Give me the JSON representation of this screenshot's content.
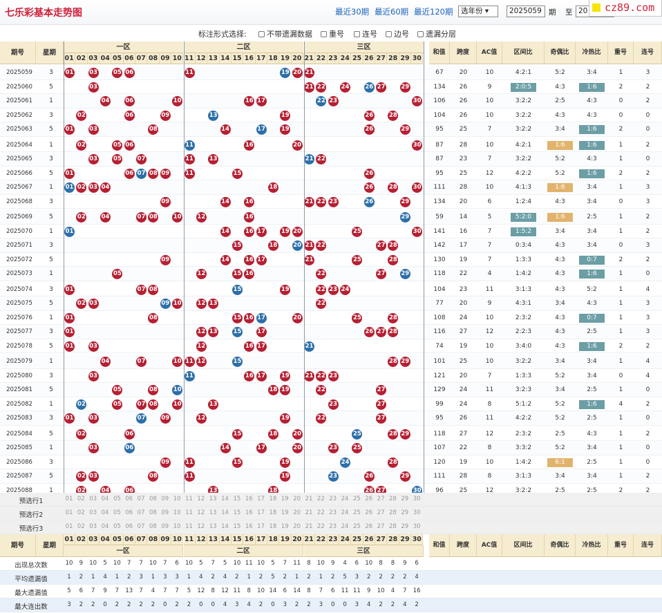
{
  "title": "七乐彩基本走势图",
  "periods": [
    "最近30期",
    "最近60期",
    "最近120期"
  ],
  "year_select": "选年份",
  "from_value": "2025059",
  "from_label": "期",
  "to_label": "至",
  "to_value": "20",
  "logo": "cz89.com",
  "options": {
    "label": "标注形式选择:",
    "items": [
      "不带遗漏数据",
      "重号",
      "连号",
      "边号",
      "遗漏分层"
    ]
  },
  "header": {
    "issue": "期号",
    "week": "星期",
    "zones": [
      "一区",
      "二区",
      "三区"
    ],
    "nums": [
      "01",
      "02",
      "03",
      "04",
      "05",
      "06",
      "07",
      "08",
      "09",
      "10",
      "11",
      "12",
      "13",
      "14",
      "15",
      "16",
      "17",
      "18",
      "19",
      "20",
      "21",
      "22",
      "23",
      "24",
      "25",
      "26",
      "27",
      "28",
      "29",
      "30"
    ],
    "cols": [
      "和值",
      "跨度",
      "AC值",
      "区间比",
      "奇偶比",
      "冷热比",
      "重号",
      "连号"
    ]
  },
  "rows": [
    {
      "id": "2025059",
      "w": "3",
      "s": "67",
      "k": "20",
      "ac": "10",
      "q": "4:2:1",
      "o": "5:2",
      "h": "3:4",
      "c": "1",
      "l": "3"
    },
    {
      "id": "2025060",
      "w": "5",
      "s": "134",
      "k": "26",
      "ac": "9",
      "q": "2:0:5",
      "o": "4:3",
      "h": "1:6",
      "c": "2",
      "l": "2"
    },
    {
      "id": "2025061",
      "w": "1",
      "s": "106",
      "k": "26",
      "ac": "10",
      "q": "3:2:2",
      "o": "2:5",
      "h": "4:3",
      "c": "0",
      "l": "2"
    },
    {
      "id": "2025062",
      "w": "3",
      "s": "104",
      "k": "26",
      "ac": "10",
      "q": "3:2:2",
      "o": "4:3",
      "h": "4:3",
      "c": "0",
      "l": "0"
    },
    {
      "id": "2025063",
      "w": "5",
      "s": "95",
      "k": "25",
      "ac": "7",
      "q": "3:2:2",
      "o": "3:4",
      "h": "1:6",
      "c": "2",
      "l": "0"
    },
    {
      "id": "2025064",
      "w": "1",
      "s": "87",
      "k": "28",
      "ac": "10",
      "q": "4:2:1",
      "o": "1:6",
      "h": "1:6",
      "c": "1",
      "l": "2"
    },
    {
      "id": "2025065",
      "w": "3",
      "s": "87",
      "k": "23",
      "ac": "7",
      "q": "3:2:2",
      "o": "5:2",
      "h": "4:3",
      "c": "1",
      "l": "0"
    },
    {
      "id": "2025066",
      "w": "5",
      "s": "95",
      "k": "25",
      "ac": "12",
      "q": "4:2:2",
      "o": "5:2",
      "h": "1:6",
      "c": "2",
      "l": "2"
    },
    {
      "id": "2025067",
      "w": "1",
      "s": "111",
      "k": "28",
      "ac": "10",
      "q": "4:1:3",
      "o": "1:6",
      "h": "3:4",
      "c": "1",
      "l": "3"
    },
    {
      "id": "2025068",
      "w": "3",
      "s": "134",
      "k": "20",
      "ac": "6",
      "q": "1:2:4",
      "o": "4:3",
      "h": "3:4",
      "c": "0",
      "l": "3"
    },
    {
      "id": "2025069",
      "w": "5",
      "s": "59",
      "k": "14",
      "ac": "5",
      "q": "5:2:0",
      "o": "1:6",
      "h": "2:5",
      "c": "1",
      "l": "2"
    },
    {
      "id": "2025070",
      "w": "1",
      "s": "141",
      "k": "16",
      "ac": "7",
      "q": "1:5:2",
      "o": "3:4",
      "h": "3:4",
      "c": "1",
      "l": "2"
    },
    {
      "id": "2025071",
      "w": "3",
      "s": "142",
      "k": "17",
      "ac": "7",
      "q": "0:3:4",
      "o": "4:3",
      "h": "3:4",
      "c": "0",
      "l": "3"
    },
    {
      "id": "2025072",
      "w": "5",
      "s": "130",
      "k": "19",
      "ac": "7",
      "q": "1:3:3",
      "o": "4:3",
      "h": "0:7",
      "c": "2",
      "l": "2"
    },
    {
      "id": "2025073",
      "w": "1",
      "s": "118",
      "k": "22",
      "ac": "4",
      "q": "1:4:2",
      "o": "4:3",
      "h": "1:6",
      "c": "1",
      "l": "0"
    },
    {
      "id": "2025074",
      "w": "3",
      "s": "104",
      "k": "23",
      "ac": "11",
      "q": "3:1:3",
      "o": "4:3",
      "h": "5:2",
      "c": "1",
      "l": "4"
    },
    {
      "id": "2025075",
      "w": "5",
      "s": "77",
      "k": "20",
      "ac": "9",
      "q": "4:3:1",
      "o": "3:4",
      "h": "4:3",
      "c": "1",
      "l": "3"
    },
    {
      "id": "2025076",
      "w": "1",
      "s": "108",
      "k": "24",
      "ac": "10",
      "q": "2:3:2",
      "o": "4:3",
      "h": "0:7",
      "c": "1",
      "l": "3"
    },
    {
      "id": "2025077",
      "w": "3",
      "s": "116",
      "k": "27",
      "ac": "12",
      "q": "2:2:3",
      "o": "4:3",
      "h": "2:5",
      "c": "1",
      "l": "3"
    },
    {
      "id": "2025078",
      "w": "5",
      "s": "74",
      "k": "19",
      "ac": "10",
      "q": "3:4:0",
      "o": "4:3",
      "h": "1:6",
      "c": "2",
      "l": "2"
    },
    {
      "id": "2025079",
      "w": "1",
      "s": "101",
      "k": "25",
      "ac": "10",
      "q": "3:2:2",
      "o": "3:4",
      "h": "3:4",
      "c": "1",
      "l": "4"
    },
    {
      "id": "2025080",
      "w": "3",
      "s": "121",
      "k": "20",
      "ac": "7",
      "q": "1:3:3",
      "o": "5:2",
      "h": "3:4",
      "c": "0",
      "l": "4"
    },
    {
      "id": "2025081",
      "w": "5",
      "s": "129",
      "k": "24",
      "ac": "11",
      "q": "3:2:3",
      "o": "3:4",
      "h": "2:5",
      "c": "1",
      "l": "0"
    },
    {
      "id": "2025082",
      "w": "1",
      "s": "99",
      "k": "24",
      "ac": "8",
      "q": "5:1:2",
      "o": "5:2",
      "h": "1:6",
      "c": "4",
      "l": "2"
    },
    {
      "id": "2025083",
      "w": "3",
      "s": "95",
      "k": "26",
      "ac": "11",
      "q": "4:2:2",
      "o": "5:2",
      "h": "2:5",
      "c": "1",
      "l": "0"
    },
    {
      "id": "2025084",
      "w": "5",
      "s": "118",
      "k": "27",
      "ac": "12",
      "q": "2:3:2",
      "o": "2:5",
      "h": "4:3",
      "c": "1",
      "l": "2"
    },
    {
      "id": "2025085",
      "w": "1",
      "s": "107",
      "k": "22",
      "ac": "8",
      "q": "3:3:2",
      "o": "5:2",
      "h": "3:4",
      "c": "1",
      "l": "0"
    },
    {
      "id": "2025086",
      "w": "3",
      "s": "120",
      "k": "19",
      "ac": "10",
      "q": "1:4:2",
      "o": "6:1",
      "h": "2:5",
      "c": "1",
      "l": "0"
    },
    {
      "id": "2025087",
      "w": "5",
      "s": "111",
      "k": "28",
      "ac": "8",
      "q": "3:1:3",
      "o": "3:4",
      "h": "3:4",
      "c": "1",
      "l": "2"
    },
    {
      "id": "2025088",
      "w": "1",
      "s": "96",
      "k": "25",
      "ac": "12",
      "q": "3:2:2",
      "o": "2:5",
      "h": "2:5",
      "c": "2",
      "l": "2"
    }
  ],
  "draws": [
    {
      "r": [
        1,
        3,
        5,
        6,
        11,
        20,
        21
      ],
      "b": [
        19
      ]
    },
    {
      "r": [
        3,
        21,
        22,
        24,
        27,
        29
      ],
      "b": [
        26
      ]
    },
    {
      "r": [
        4,
        6,
        10,
        16,
        17,
        23,
        30
      ],
      "b": [
        22
      ]
    },
    {
      "r": [
        2,
        6,
        9,
        19,
        26,
        28
      ],
      "b": [
        13
      ]
    },
    {
      "r": [
        1,
        3,
        8,
        14,
        19,
        26,
        29
      ],
      "b": [
        17
      ]
    },
    {
      "r": [
        2,
        5,
        6,
        11,
        16,
        20,
        30
      ],
      "b": [
        11
      ]
    },
    {
      "r": [
        3,
        5,
        7,
        11,
        13,
        21,
        22
      ],
      "b": [
        21
      ]
    },
    {
      "r": [
        1,
        6,
        8,
        9,
        11,
        15,
        26
      ],
      "b": [
        7
      ]
    },
    {
      "r": [
        2,
        3,
        4,
        18,
        26,
        28,
        30
      ],
      "b": [
        1
      ]
    },
    {
      "r": [
        9,
        14,
        16,
        21,
        22,
        23,
        29
      ],
      "b": [
        26
      ]
    },
    {
      "r": [
        2,
        4,
        7,
        8,
        10,
        12,
        16
      ],
      "b": [
        29
      ]
    },
    {
      "r": [
        14,
        16,
        17,
        19,
        20,
        25,
        30
      ],
      "b": [
        1
      ]
    },
    {
      "r": [
        15,
        18,
        21,
        22,
        27,
        28
      ],
      "b": [
        20
      ]
    },
    {
      "r": [
        9,
        14,
        16,
        17,
        21,
        25,
        28
      ],
      "b": []
    },
    {
      "r": [
        5,
        12,
        15,
        16,
        22,
        27
      ],
      "b": [
        29
      ]
    },
    {
      "r": [
        1,
        7,
        8,
        19,
        22,
        23,
        24
      ],
      "b": [
        15
      ]
    },
    {
      "r": [
        2,
        3,
        10,
        12,
        13,
        22
      ],
      "b": [
        9
      ]
    },
    {
      "r": [
        1,
        8,
        15,
        16,
        20,
        25,
        28
      ],
      "b": [
        17
      ]
    },
    {
      "r": [
        1,
        12,
        13,
        17,
        26,
        27,
        28
      ],
      "b": [
        15
      ]
    },
    {
      "r": [
        1,
        3,
        12,
        16,
        17,
        21,
        21
      ],
      "b": [
        21
      ]
    },
    {
      "r": [
        4,
        7,
        10,
        11,
        12,
        28,
        29
      ],
      "b": [
        15
      ]
    },
    {
      "r": [
        3,
        16,
        17,
        19,
        21,
        22,
        23
      ],
      "b": [
        11
      ]
    },
    {
      "r": [
        5,
        8,
        18,
        19,
        22,
        27
      ],
      "b": [
        10
      ]
    },
    {
      "r": [
        5,
        7,
        8,
        10,
        13,
        23,
        27
      ],
      "b": [
        2
      ]
    },
    {
      "r": [
        1,
        3,
        9,
        12,
        19,
        22,
        27
      ],
      "b": [
        7
      ]
    },
    {
      "r": [
        2,
        6,
        15,
        18,
        20,
        28,
        29
      ],
      "b": [
        25
      ]
    },
    {
      "r": [
        3,
        14,
        17,
        20,
        23,
        25
      ],
      "b": [
        6
      ]
    },
    {
      "r": [
        9,
        11,
        15,
        19,
        24,
        28
      ],
      "b": [
        24
      ]
    },
    {
      "r": [
        2,
        3,
        8,
        11,
        19,
        26,
        29
      ],
      "b": [
        23
      ]
    },
    {
      "r": [
        2,
        4,
        6,
        13,
        18,
        26,
        27
      ],
      "b": [
        30
      ]
    }
  ],
  "hl": {
    "q": [
      1,
      10,
      11
    ],
    "o": [
      5,
      8,
      10,
      27
    ],
    "h": [
      1,
      4,
      5,
      7,
      13,
      14,
      17,
      19,
      23
    ]
  },
  "pre": [
    "预选行1",
    "预选行2",
    "预选行3"
  ],
  "foot": {
    "issue": "期号",
    "week": "星期",
    "zones": [
      "一区",
      "二区",
      "三区"
    ],
    "cols": [
      "和值",
      "跨度",
      "AC值",
      "区间比",
      "奇偶比",
      "冷热比",
      "重号",
      "连号"
    ]
  },
  "stats": [
    {
      "label": "出现总次数",
      "v": [
        "10",
        "9",
        "10",
        "5",
        "10",
        "7",
        "7",
        "10",
        "7",
        "6",
        "10",
        "5",
        "7",
        "5",
        "10",
        "11",
        "10",
        "5",
        "7",
        "11",
        "8",
        "10",
        "9",
        "4",
        "6",
        "10",
        "8",
        "8",
        "9",
        "6"
      ]
    },
    {
      "label": "平均遗漏值",
      "v": [
        "1",
        "2",
        "1",
        "4",
        "1",
        "2",
        "3",
        "1",
        "3",
        "3",
        "1",
        "4",
        "2",
        "4",
        "2",
        "1",
        "2",
        "5",
        "2",
        "1",
        "2",
        "1",
        "2",
        "5",
        "3",
        "2",
        "2",
        "2",
        "2",
        "4"
      ]
    },
    {
      "label": "最大遗漏值",
      "v": [
        "5",
        "6",
        "7",
        "9",
        "7",
        "13",
        "7",
        "4",
        "7",
        "7",
        "5",
        "12",
        "8",
        "12",
        "11",
        "8",
        "10",
        "14",
        "6",
        "14",
        "8",
        "7",
        "6",
        "11",
        "11",
        "9",
        "10",
        "4",
        "7",
        "16"
      ]
    },
    {
      "label": "最大连出数",
      "v": [
        "3",
        "2",
        "2",
        "0",
        "2",
        "2",
        "2",
        "2",
        "0",
        "2",
        "2",
        "0",
        "0",
        "4",
        "3",
        "4",
        "2",
        "0",
        "3",
        "2",
        "2",
        "3",
        "0",
        "0",
        "3",
        "4",
        "2",
        "2",
        "4",
        "2"
      ]
    }
  ]
}
